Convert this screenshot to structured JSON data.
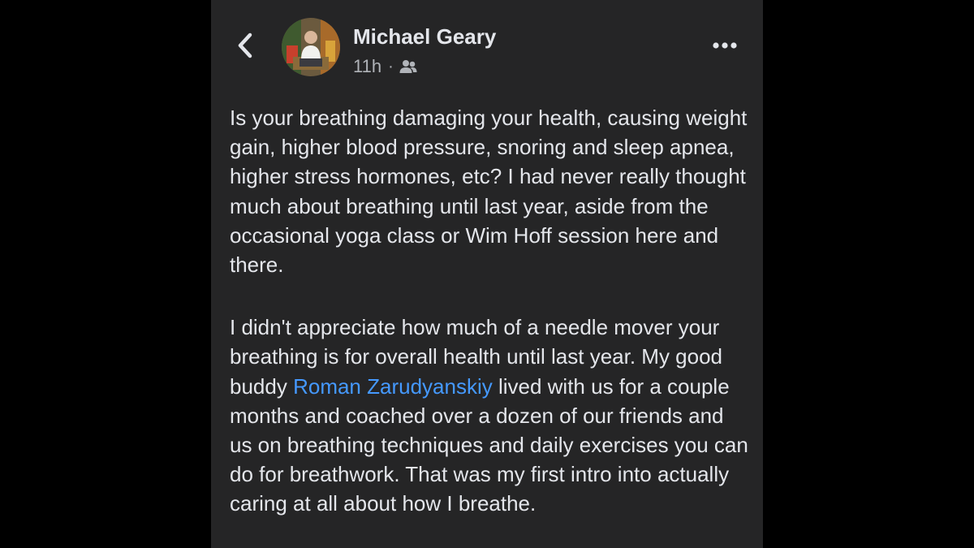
{
  "header": {
    "back_icon": "chevron-left-icon",
    "author_name": "Michael Geary",
    "timestamp": "11h",
    "meta_separator": "·",
    "audience_icon": "friends-audience-icon",
    "more_icon": "more-horizontal-icon"
  },
  "post": {
    "paragraph1": "Is your breathing damaging your health, causing weight gain, higher blood pressure, snoring and sleep apnea, higher stress hormones, etc?  I had never really thought much about breathing until last year, aside from the occasional yoga class or Wim Hoff session here and there.",
    "paragraph2": {
      "before_mention": "I didn't appreciate how much of a needle mover your breathing is for overall health until last year. My good buddy ",
      "mention": "Roman Zarudyanskiy",
      "after_mention": " lived with us for a couple months and coached over a dozen of our friends and us on breathing techniques and daily exercises you can do for breathwork.  That was my first intro into actually caring at all about how I breathe."
    }
  },
  "colors": {
    "page_background": "#000000",
    "card_background": "#252526",
    "primary_text": "#e4e6eb",
    "secondary_text": "#b0b3b8",
    "mention_link": "#4599ff"
  }
}
